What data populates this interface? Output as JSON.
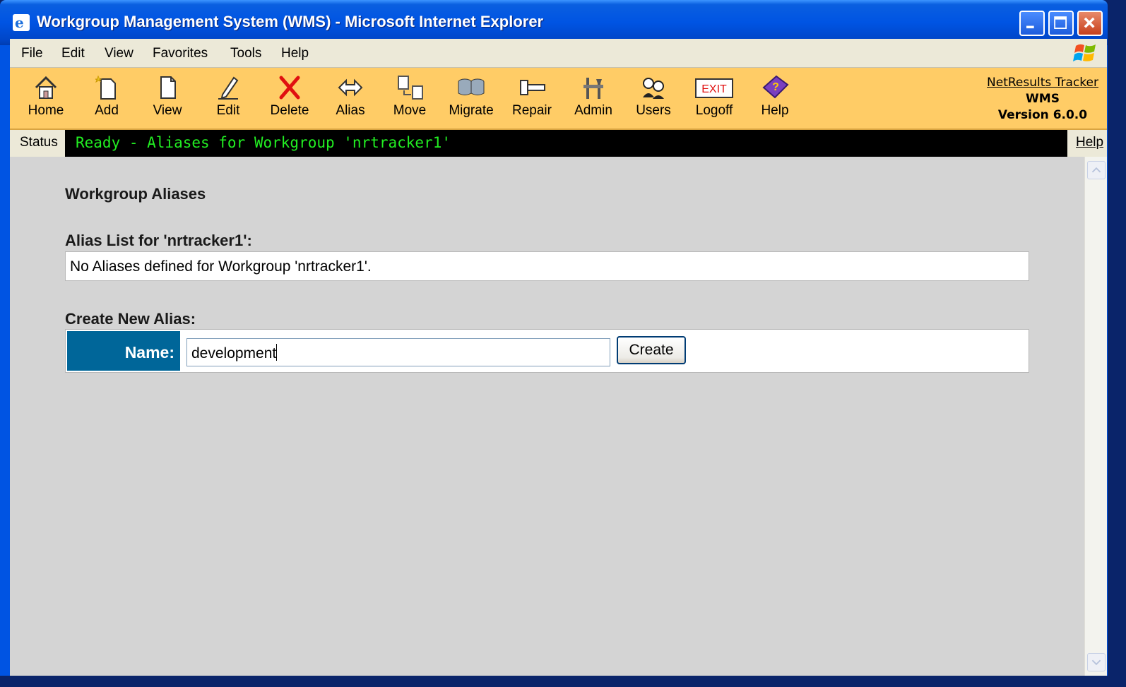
{
  "window": {
    "title": "Workgroup Management System (WMS) - Microsoft Internet Explorer"
  },
  "menubar": {
    "items": [
      "File",
      "Edit",
      "View",
      "Favorites",
      "Tools",
      "Help"
    ]
  },
  "toolbar": {
    "buttons": [
      {
        "label": "Home",
        "icon": "home-icon"
      },
      {
        "label": "Add",
        "icon": "add-document-icon"
      },
      {
        "label": "View",
        "icon": "document-icon"
      },
      {
        "label": "Edit",
        "icon": "pencil-icon"
      },
      {
        "label": "Delete",
        "icon": "red-x-icon"
      },
      {
        "label": "Alias",
        "icon": "double-arrow-icon"
      },
      {
        "label": "Move",
        "icon": "move-icon"
      },
      {
        "label": "Migrate",
        "icon": "database-icon"
      },
      {
        "label": "Repair",
        "icon": "hammer-icon"
      },
      {
        "label": "Admin",
        "icon": "tools-icon"
      },
      {
        "label": "Users",
        "icon": "users-icon"
      },
      {
        "label": "Logoff",
        "icon": "exit-sign-icon"
      },
      {
        "label": "Help",
        "icon": "help-book-icon"
      }
    ],
    "exit_sign_text": "EXIT",
    "product": {
      "name": "NetResults Tracker",
      "subtitle": "WMS",
      "version": "Version 6.0.0"
    }
  },
  "statusbar": {
    "label": "Status",
    "message": "Ready - Aliases for Workgroup 'nrtracker1'",
    "help": "Help"
  },
  "main": {
    "heading": "Workgroup Aliases",
    "alias_list_label": "Alias List for 'nrtracker1':",
    "alias_list_text": "No Aliases defined for Workgroup 'nrtracker1'.",
    "create_label": "Create New Alias:",
    "name_label": "Name:",
    "name_value": "development",
    "create_button": "Create"
  },
  "colors": {
    "toolbar_bg": "#ffcc66",
    "status_text": "#22ee22",
    "name_label_bg": "#006699",
    "content_bg": "#d4d4d4"
  }
}
